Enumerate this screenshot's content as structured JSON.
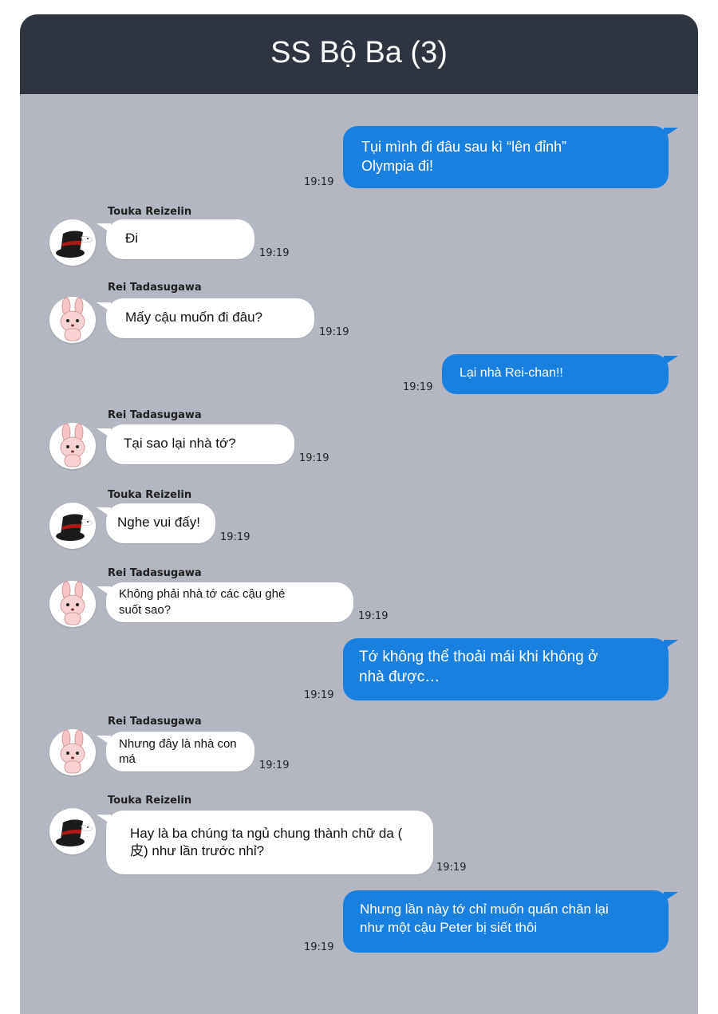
{
  "chat": {
    "title": "SS Bộ Ba (3)",
    "messages": [
      {
        "from": "me",
        "text": "Tụi mình đi đâu sau kì “lên đỉnh”\n Olympia đi!",
        "time": "19:19"
      },
      {
        "from": "Touka Reizelin",
        "avatar": "top-hat-icon",
        "text": "Đi",
        "time": "19:19"
      },
      {
        "from": "Rei Tadasugawa",
        "avatar": "bunny-icon",
        "text": "Mấy cậu muốn đi đâu?",
        "time": "19:19"
      },
      {
        "from": "me",
        "text": "Lại nhà Rei-chan!!",
        "time": "19:19"
      },
      {
        "from": "Rei Tadasugawa",
        "avatar": "bunny-icon",
        "text": "Tại sao lại nhà tớ?",
        "time": "19:19"
      },
      {
        "from": "Touka Reizelin",
        "avatar": "top-hat-icon",
        "text": "Nghe vui đấy!",
        "time": "19:19"
      },
      {
        "from": "Rei Tadasugawa",
        "avatar": "bunny-icon",
        "text": "Không phải nhà tớ các cậu ghé\nsuốt sao?",
        "time": "19:19"
      },
      {
        "from": "me",
        "text": "Tớ không thể thoải mái khi không ở\nnhà được…",
        "time": "19:19"
      },
      {
        "from": "Rei Tadasugawa",
        "avatar": "bunny-icon",
        "text": "Nhưng đây là nhà con\nmá",
        "time": "19:19"
      },
      {
        "from": "Touka Reizelin",
        "avatar": "top-hat-icon",
        "text": "Hay là ba chúng ta ngủ chung thành chữ da (\n皮) như lần trước nhỉ?",
        "time": "19:19"
      },
      {
        "from": "me",
        "text": "Nhưng lần này tớ chỉ muốn quấn chăn lại\nnhư một cậu Peter bị siết thôi",
        "time": "19:19"
      }
    ]
  },
  "colors": {
    "header": "#2e3440",
    "background": "#b4b7c1",
    "outgoing_bubble": "#1a80e0",
    "incoming_bubble": "#ffffff"
  }
}
